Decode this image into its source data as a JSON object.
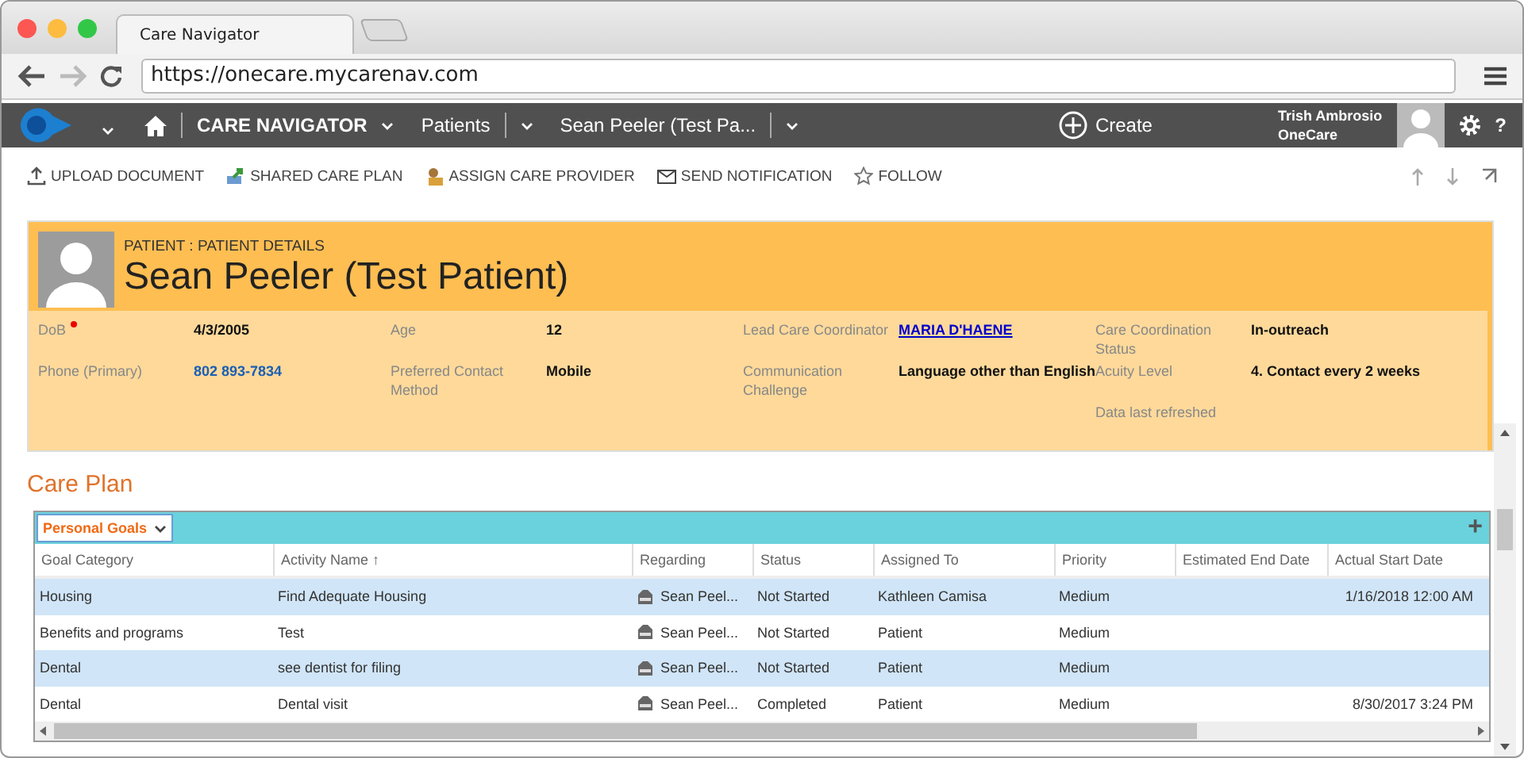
{
  "browser": {
    "tab_title": "Care Navigator",
    "url": "https://onecare.mycarenav.com"
  },
  "navbar": {
    "app": "CARE NAVIGATOR",
    "area": "Patients",
    "record": "Sean Peeler (Test Pa...",
    "create": "Create",
    "user_name": "Trish Ambrosio",
    "user_org": "OneCare",
    "help": "?"
  },
  "commands": [
    {
      "label": "UPLOAD DOCUMENT",
      "kind": "upload"
    },
    {
      "label": "SHARED CARE PLAN",
      "kind": "share"
    },
    {
      "label": "ASSIGN CARE PROVIDER",
      "kind": "assign"
    },
    {
      "label": "SEND NOTIFICATION",
      "kind": "mail"
    },
    {
      "label": "FOLLOW",
      "kind": "star"
    }
  ],
  "header": {
    "breadcrumb": "PATIENT : PATIENT DETAILS",
    "name": "Sean Peeler (Test Patient)",
    "columns": [
      [
        {
          "label": "DoB",
          "required": true,
          "value": "4/3/2005",
          "kind": "text"
        },
        {
          "label": "Phone (Primary)",
          "required": false,
          "value": "802 893-7834",
          "kind": "phone"
        }
      ],
      [
        {
          "label": "Age",
          "required": false,
          "value": "12",
          "kind": "text"
        },
        {
          "label": "Preferred Contact Method",
          "required": false,
          "value": "Mobile",
          "kind": "text"
        }
      ],
      [
        {
          "label": "Lead Care Coordinator",
          "required": false,
          "value": "MARIA D'HAENE",
          "kind": "link"
        },
        {
          "label": "Communication Challenge",
          "required": false,
          "value": "Language other than English",
          "kind": "text"
        }
      ],
      [
        {
          "label": "Care Coordination Status",
          "required": false,
          "value": "In-outreach",
          "kind": "text"
        },
        {
          "label": "Acuity Level",
          "required": false,
          "value": "4. Contact every 2 weeks",
          "kind": "text"
        },
        {
          "label": "Data last refreshed",
          "required": false,
          "kind": "text"
        }
      ]
    ]
  },
  "section_title": "Care Plan",
  "grid": {
    "view": "Personal Goals",
    "add": "+",
    "columns": [
      "Goal Category",
      "Activity Name ↑",
      "Regarding",
      "Status",
      "Assigned To",
      "Priority",
      "Estimated End Date",
      "Actual Start Date"
    ],
    "rows": [
      {
        "selected": true,
        "cells": [
          "Housing",
          "Find Adequate Housing",
          "Sean Peel...",
          "Not Started",
          "Kathleen Camisa",
          "Medium",
          "",
          "1/16/2018 12:00 AM"
        ]
      },
      {
        "selected": false,
        "cells": [
          "Benefits and programs",
          "Test",
          "Sean Peel...",
          "Not Started",
          "Patient",
          "Medium",
          "",
          ""
        ]
      },
      {
        "selected": true,
        "cells": [
          "Dental",
          "see dentist for filing",
          "Sean Peel...",
          "Not Started",
          "Patient",
          "Medium",
          "",
          ""
        ]
      },
      {
        "selected": false,
        "cells": [
          "Dental",
          "Dental visit",
          "Sean Peel...",
          "Completed",
          "Patient",
          "Medium",
          "",
          "8/30/2017 3:24 PM"
        ]
      }
    ]
  }
}
